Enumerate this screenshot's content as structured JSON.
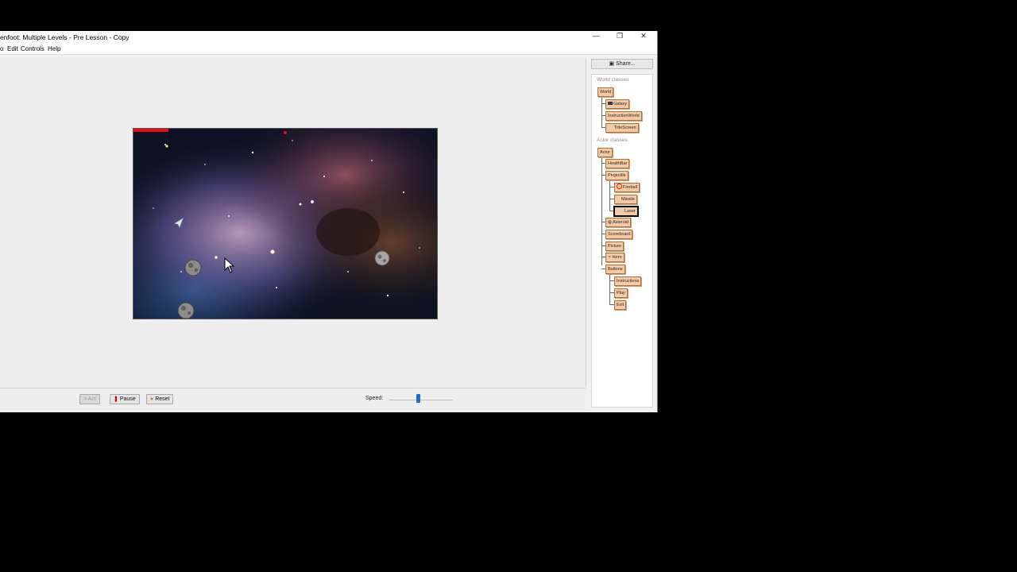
{
  "window": {
    "title": "enfoot: Multiple Levels - Pre Lesson - Copy",
    "controls": {
      "minimize": "—",
      "restore": "❐",
      "close": "✕"
    }
  },
  "menu": [
    "o",
    "Edit",
    "Controls",
    "Help"
  ],
  "controls": {
    "act": "Act",
    "pause": "Pause",
    "reset": "Reset",
    "speed_label": "Speed:",
    "speed_value": 0.45
  },
  "panel": {
    "share": "Share...",
    "world_classes_label": "World classes",
    "actor_classes_label": "Actor classes",
    "world_classes": [
      "World",
      "Galaxy",
      "InstructionWorld",
      "TitleScreen"
    ],
    "actor_classes": [
      "Actor",
      "HealthBar",
      "Projectile",
      "Fireball",
      "Missile",
      "Laser",
      "Asteroid",
      "Scoreboard",
      "Picture",
      "Hero",
      "Buttons",
      "Instructions",
      "Play",
      "Exit"
    ]
  },
  "colors": {
    "class_fill": "#f5c9a3",
    "health_bar": "#e01010",
    "slider_thumb": "#1a6fd1"
  }
}
